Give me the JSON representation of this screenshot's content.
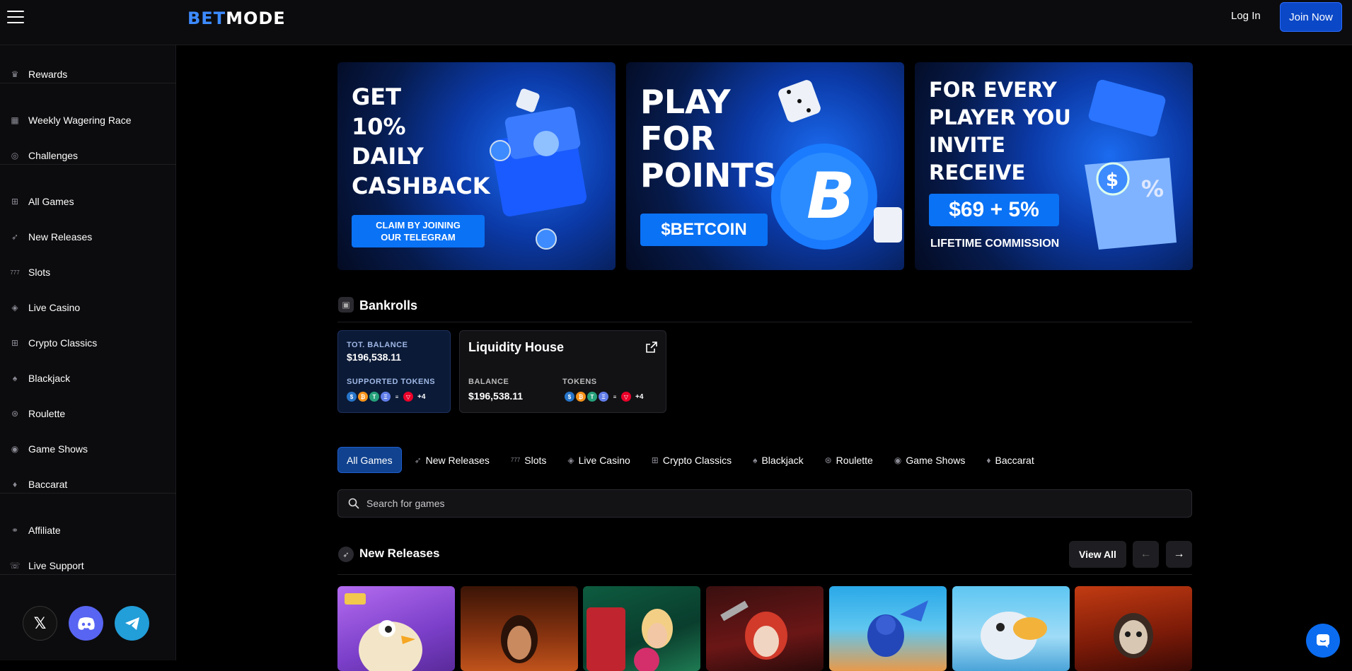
{
  "header": {
    "logo_bet": "BET",
    "logo_mode": "MODE",
    "login": "Log In",
    "join": "Join Now"
  },
  "sidebar": {
    "items": [
      {
        "label": "Rewards",
        "icon": "crown-icon"
      },
      {
        "label": "Weekly Wagering Race",
        "icon": "calendar-icon"
      },
      {
        "label": "Challenges",
        "icon": "target-icon"
      },
      {
        "label": "All Games",
        "icon": "grid-icon"
      },
      {
        "label": "New Releases",
        "icon": "rocket-icon"
      },
      {
        "label": "Slots",
        "icon": "slots-777-icon"
      },
      {
        "label": "Live Casino",
        "icon": "diamond-icon"
      },
      {
        "label": "Crypto Classics",
        "icon": "grid-icon"
      },
      {
        "label": "Blackjack",
        "icon": "spade-icon"
      },
      {
        "label": "Roulette",
        "icon": "roulette-icon"
      },
      {
        "label": "Game Shows",
        "icon": "microphone-icon"
      },
      {
        "label": "Baccarat",
        "icon": "cards-icon"
      },
      {
        "label": "Affiliate",
        "icon": "affiliate-icon"
      },
      {
        "label": "Live Support",
        "icon": "support-icon"
      }
    ]
  },
  "banners": [
    {
      "headline": "GET\n10%\nDAILY\nCASHBACK",
      "cta": "CLAIM BY JOINING\nOUR TELEGRAM"
    },
    {
      "headline": "PLAY\nFOR\nPOINTS",
      "cta": "$BETCOIN"
    },
    {
      "headline": "FOR EVERY\nPLAYER YOU\nINVITE\nRECEIVE",
      "cta": "$69 + 5%",
      "sub": "LIFETIME COMMISSION"
    }
  ],
  "bankrolls": {
    "title": "Bankrolls",
    "total": {
      "label": "TOT. BALANCE",
      "value": "$196,538.11",
      "tokens_label": "SUPPORTED TOKENS",
      "more": "+4"
    },
    "house": {
      "name": "Liquidity House",
      "balance_label": "BALANCE",
      "balance": "$196,538.11",
      "tokens_label": "TOKENS",
      "more": "+4"
    }
  },
  "tabs": [
    {
      "label": "All Games",
      "icon": ""
    },
    {
      "label": "New Releases",
      "icon": "➶"
    },
    {
      "label": "Slots",
      "icon": "777"
    },
    {
      "label": "Live Casino",
      "icon": "◈"
    },
    {
      "label": "Crypto Classics",
      "icon": "⊞"
    },
    {
      "label": "Blackjack",
      "icon": "♠"
    },
    {
      "label": "Roulette",
      "icon": "◎"
    },
    {
      "label": "Game Shows",
      "icon": "◉"
    },
    {
      "label": "Baccarat",
      "icon": "♦"
    }
  ],
  "search": {
    "placeholder": "Search for games"
  },
  "new_releases": {
    "title": "New Releases",
    "view_all": "View All"
  },
  "colors": {
    "accent": "#0b48c7",
    "bg": "#000000",
    "panel": "#0c0c0e"
  }
}
